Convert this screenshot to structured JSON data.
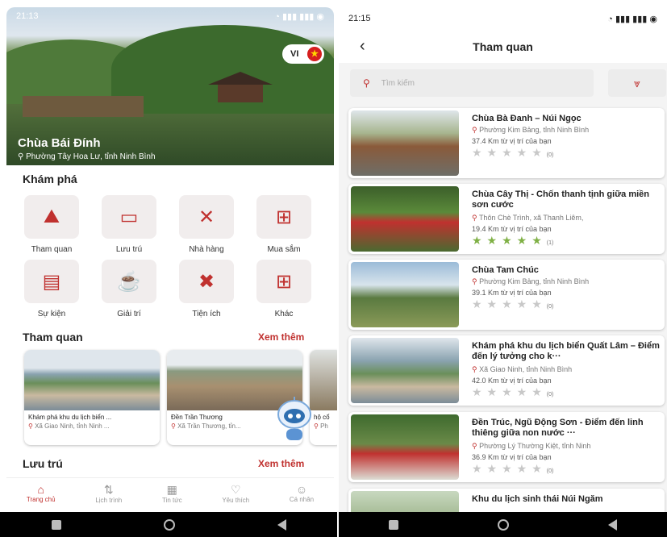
{
  "left": {
    "status_time": "21:13",
    "lang": "VI",
    "hero": {
      "title": "Chùa Bái Đính",
      "address": "Phường Tây Hoa Lư, tỉnh Ninh Bình"
    },
    "explore_title": "Khám phá",
    "categories": [
      {
        "label": "Tham quan",
        "icon": "sightseeing-icon"
      },
      {
        "label": "Lưu trú",
        "icon": "bed-icon"
      },
      {
        "label": "Nhà hàng",
        "icon": "restaurant-icon"
      },
      {
        "label": "Mua sắm",
        "icon": "cart-icon"
      },
      {
        "label": "Sự kiện",
        "icon": "calendar-icon"
      },
      {
        "label": "Giải trí",
        "icon": "coffee-icon"
      },
      {
        "label": "Tiện ích",
        "icon": "tools-icon"
      },
      {
        "label": "Khác",
        "icon": "grid-plus-icon"
      }
    ],
    "sightseeing_title": "Tham quan",
    "see_more": "Xem thêm",
    "cards": [
      {
        "title": "Khám phá khu du lịch biển ...",
        "address": "Xã Giao Ninh, tỉnh Ninh ..."
      },
      {
        "title": "Đền Trần Thương",
        "address": "Xã Trần Thương, tỉn..."
      },
      {
        "title": "hộ cổ",
        "address": "Ph"
      }
    ],
    "stay_title": "Lưu trú",
    "stay_more": "Xem thêm",
    "bottom_nav": [
      {
        "label": "Trang chủ",
        "icon": "home-icon",
        "active": true
      },
      {
        "label": "Lịch trình",
        "icon": "route-icon",
        "active": false
      },
      {
        "label": "Tin tức",
        "icon": "news-icon",
        "active": false
      },
      {
        "label": "Yêu thích",
        "icon": "favorite-icon",
        "active": false
      },
      {
        "label": "Cá nhân",
        "icon": "profile-icon",
        "active": false
      }
    ]
  },
  "right": {
    "status_time": "21:15",
    "title": "Tham quan",
    "search_placeholder": "Tìm kiếm",
    "items": [
      {
        "title": "Chùa Bà Đanh – Núi Ngọc",
        "address": "Phường Kim Bảng, tỉnh Ninh Bình",
        "distance": "37.4 Km từ vị trí của bạn",
        "rating_count": "(0)",
        "rated": false
      },
      {
        "title": "Chùa Cây Thị - Chốn thanh tịnh giữa miền sơn cước",
        "address": "Thôn Chè Trình, xã Thanh Liêm,",
        "distance": "19.4 Km từ vị trí của bạn",
        "rating_count": "(1)",
        "rated": true
      },
      {
        "title": "Chùa Tam Chúc",
        "address": "Phường Kim Bảng, tỉnh Ninh Bình",
        "distance": "39.1 Km từ vị trí của bạn",
        "rating_count": "(0)",
        "rated": false
      },
      {
        "title": "Khám phá khu du lịch biển Quất Lâm – Điểm đến lý tưởng cho k···",
        "address": "Xã Giao Ninh, tỉnh Ninh Bình",
        "distance": "42.0 Km từ vị trí của bạn",
        "rating_count": "(0)",
        "rated": false
      },
      {
        "title": "Đền Trúc, Ngũ Động Sơn - Điểm đến linh thiêng giữa non nước ···",
        "address": "Phường Lý Thường Kiệt, tỉnh Ninh",
        "distance": "36.9 Km từ vị trí của bạn",
        "rating_count": "(0)",
        "rated": false
      },
      {
        "title": "Khu du lịch sinh thái Núi Ngăm",
        "address": "",
        "distance": "",
        "rating_count": "",
        "rated": false
      }
    ]
  }
}
